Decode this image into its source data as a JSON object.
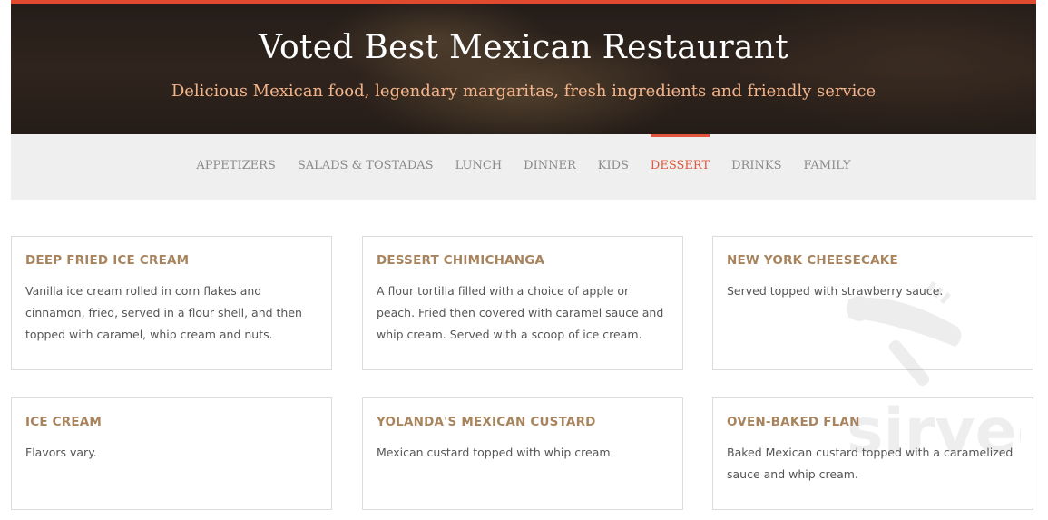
{
  "hero": {
    "title": "Voted Best Mexican Restaurant",
    "subtitle": "Delicious Mexican food, legendary margaritas, fresh ingredients and friendly service"
  },
  "nav": {
    "items": [
      {
        "label": "APPETIZERS"
      },
      {
        "label": "SALADS & TOSTADAS"
      },
      {
        "label": "LUNCH"
      },
      {
        "label": "DINNER"
      },
      {
        "label": "KIDS"
      },
      {
        "label": "DESSERT",
        "active": true
      },
      {
        "label": "DRINKS"
      },
      {
        "label": "FAMILY"
      }
    ]
  },
  "menu": {
    "items": [
      {
        "name": "DEEP FRIED ICE CREAM",
        "description": "Vanilla ice cream rolled in corn flakes and cinnamon, fried, served in a flour shell, and then topped with caramel, whip cream and nuts."
      },
      {
        "name": "DESSERT CHIMICHANGA",
        "description": "A flour tortilla filled with a choice of apple or peach. Fried then covered with caramel sauce and whip cream. Served with a scoop of ice cream."
      },
      {
        "name": "NEW YORK CHEESECAKE",
        "description": "Served topped with strawberry sauce."
      },
      {
        "name": "ICE CREAM",
        "description": "Flavors vary."
      },
      {
        "name": "YOLANDA'S MEXICAN CUSTARD",
        "description": "Mexican custard topped with whip cream."
      },
      {
        "name": "OVEN-BAKED FLAN",
        "description": "Baked Mexican custard topped with a caramelized sauce and whip cream."
      }
    ]
  },
  "watermark": {
    "text": "sirved",
    "icon": "utensils-icon"
  },
  "colors": {
    "accent": "#e0553c",
    "title_text": "#a8845e",
    "subtitle_text": "#f3b48a",
    "nav_bg": "#efefef"
  }
}
